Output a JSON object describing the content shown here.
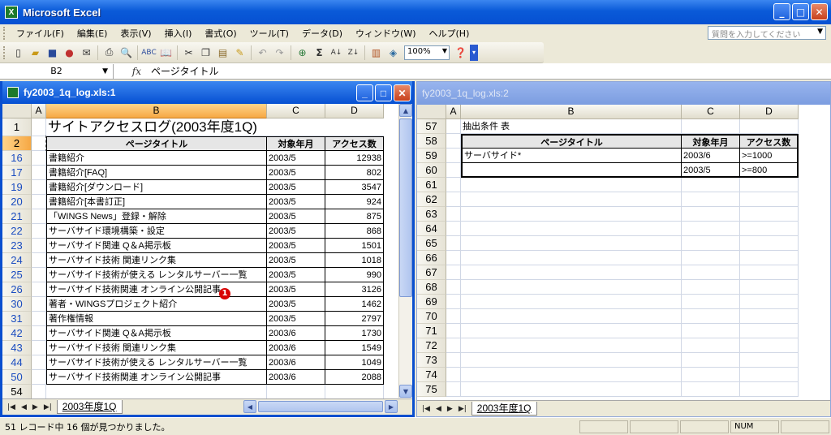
{
  "app": {
    "title": "Microsoft Excel",
    "icon": "excel-icon"
  },
  "menu": [
    "ファイル(F)",
    "編集(E)",
    "表示(V)",
    "挿入(I)",
    "書式(O)",
    "ツール(T)",
    "データ(D)",
    "ウィンドウ(W)",
    "ヘルプ(H)"
  ],
  "help_placeholder": "質問を入力してください",
  "toolbar": {
    "zoom": "100%"
  },
  "formula": {
    "cell": "B2",
    "fx": "fx",
    "content": "ページタイトル"
  },
  "left": {
    "title": "fy2003_1q_log.xls:1",
    "cols": [
      "A",
      "B",
      "C",
      "D"
    ],
    "title_row": {
      "num": "1",
      "text": "サイトアクセスログ(2003年度1Q)"
    },
    "header_row": {
      "num": "2",
      "b": "ページタイトル",
      "c": "対象年月",
      "d": "アクセス数"
    },
    "rows": [
      {
        "num": "16",
        "b": "書籍紹介",
        "c": "2003/5",
        "d": "12938"
      },
      {
        "num": "17",
        "b": "書籍紹介[FAQ]",
        "c": "2003/5",
        "d": "802"
      },
      {
        "num": "19",
        "b": "書籍紹介[ダウンロード]",
        "c": "2003/5",
        "d": "3547"
      },
      {
        "num": "20",
        "b": "書籍紹介[本書訂正]",
        "c": "2003/5",
        "d": "924"
      },
      {
        "num": "21",
        "b": "「WINGS News」登録・解除",
        "c": "2003/5",
        "d": "875"
      },
      {
        "num": "22",
        "b": "サーバサイド環境構築・設定",
        "c": "2003/5",
        "d": "868"
      },
      {
        "num": "23",
        "b": "サーバサイド関連 Q＆A掲示板",
        "c": "2003/5",
        "d": "1501"
      },
      {
        "num": "24",
        "b": "サーバサイド技術 関連リンク集",
        "c": "2003/5",
        "d": "1018"
      },
      {
        "num": "25",
        "b": "サーバサイド技術が使える レンタルサーバー一覧",
        "c": "2003/5",
        "d": "990"
      },
      {
        "num": "26",
        "b": "サーバサイド技術関連 オンライン公開記事",
        "c": "2003/5",
        "d": "3126"
      },
      {
        "num": "30",
        "b": "著者・WINGSプロジェクト紹介",
        "c": "2003/5",
        "d": "1462"
      },
      {
        "num": "31",
        "b": "著作権情報",
        "c": "2003/5",
        "d": "2797"
      },
      {
        "num": "42",
        "b": "サーバサイド関連 Q＆A掲示板",
        "c": "2003/6",
        "d": "1730"
      },
      {
        "num": "43",
        "b": "サーバサイド技術 関連リンク集",
        "c": "2003/6",
        "d": "1549"
      },
      {
        "num": "44",
        "b": "サーバサイド技術が使える レンタルサーバー一覧",
        "c": "2003/6",
        "d": "1049"
      },
      {
        "num": "50",
        "b": "サーバサイド技術関連 オンライン公開記事",
        "c": "2003/6",
        "d": "2088"
      }
    ],
    "last_row": "54",
    "marker": "1",
    "sheet_tab": "2003年度1Q"
  },
  "right": {
    "title": "fy2003_1q_log.xls:2",
    "cols": [
      "A",
      "B",
      "C",
      "D"
    ],
    "caption_row": {
      "num": "57",
      "text": "抽出条件 表"
    },
    "header_row": {
      "num": "58",
      "b": "ページタイトル",
      "c": "対象年月",
      "d": "アクセス数"
    },
    "crit_rows": [
      {
        "num": "59",
        "b": "サーバサイド*",
        "c": "2003/6",
        "d": ">=1000"
      },
      {
        "num": "60",
        "b": "",
        "c": "2003/5",
        "d": ">=800"
      }
    ],
    "empty_rows": [
      "61",
      "62",
      "63",
      "64",
      "65",
      "66",
      "67",
      "68",
      "69",
      "70",
      "71",
      "72",
      "73",
      "74",
      "75"
    ],
    "sheet_tab": "2003年度1Q"
  },
  "status": {
    "text": "51 レコード中 16 個が見つかりました。",
    "num": "NUM"
  }
}
